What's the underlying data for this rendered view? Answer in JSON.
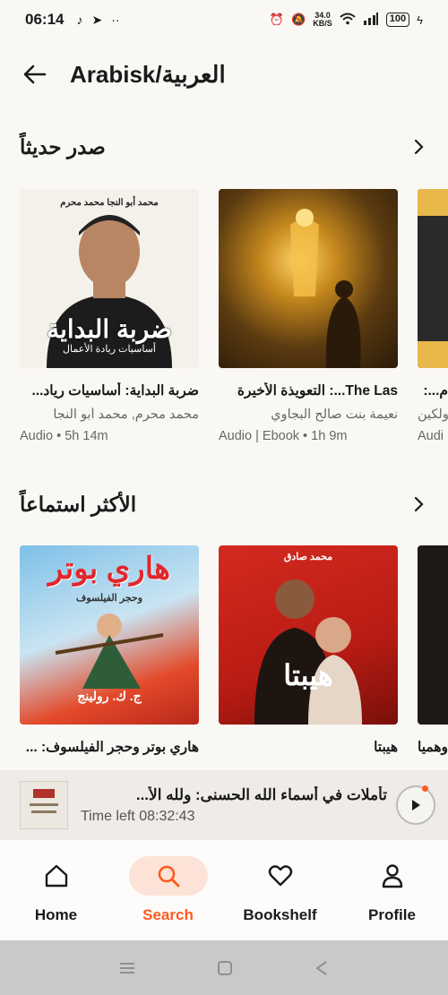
{
  "status": {
    "time": "06:14",
    "network_speed": "34.0",
    "network_unit": "KB/S",
    "battery": "100"
  },
  "header": {
    "title": "Arabisk/العربية"
  },
  "sections": [
    {
      "title": "صدر حديثاً",
      "books": [
        {
          "title": "ضربة البداية: أساسيات رياد...",
          "author": "محمد محرم, محمد أبو النجا",
          "meta": "Audio • 5h 14m",
          "cover_title": "ضربة البداية",
          "cover_sub": "أساسيات ريادة الأعمال",
          "cover_authors": "محمد أبو النجا   محمد محرم"
        },
        {
          "title": "The Las...: التعويذة الأخيرة",
          "author": "نعيمة بنت صالح البجاوي",
          "meta": "Audio | Ebook • 1h 9m"
        },
        {
          "title": "م...:",
          "author": "ولكين",
          "meta": "Audi"
        }
      ]
    },
    {
      "title": "الأكثر استماعاً",
      "books": [
        {
          "title": "هاري بوتر وحجر الفيلسوف: ...",
          "cover_title": "هاري بوتر",
          "cover_sub": "وحجر الفيلسوف",
          "cover_author": "ج. ك. رولينج"
        },
        {
          "title": "هيبتا",
          "cover_title": "هيبتا",
          "cover_author": "محمد صادق"
        },
        {
          "title": "وهميا"
        }
      ]
    }
  ],
  "mini_player": {
    "title": "تأملات في أسماء الله الحسنى: ولله الأ...",
    "time_left": "Time left 08:32:43"
  },
  "tabs": [
    {
      "label": "Home",
      "icon": "home-icon"
    },
    {
      "label": "Search",
      "icon": "search-icon",
      "active": true
    },
    {
      "label": "Bookshelf",
      "icon": "heart-icon"
    },
    {
      "label": "Profile",
      "icon": "person-icon"
    }
  ],
  "colors": {
    "accent": "#ff5a1f",
    "background": "#faf8f5"
  }
}
